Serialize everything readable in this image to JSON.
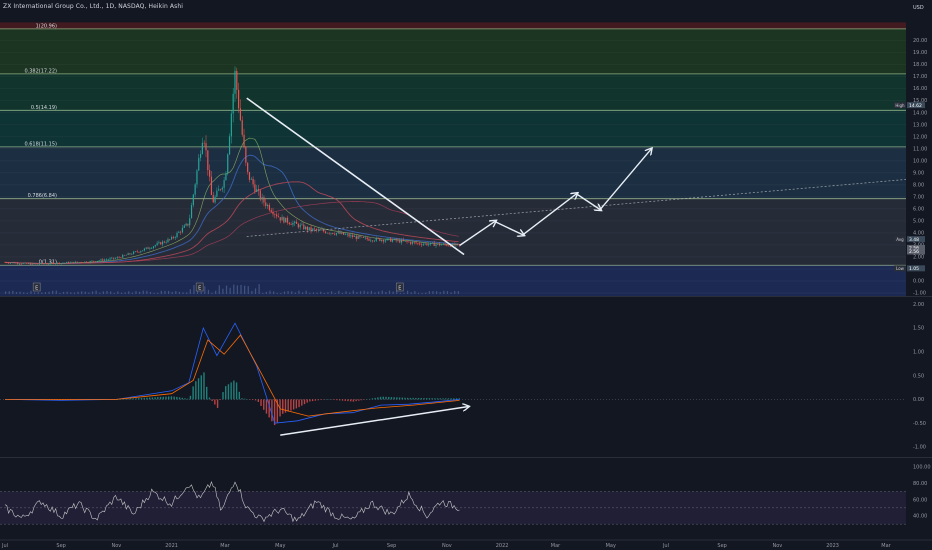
{
  "header": {
    "title": "ZX International Group Co., Ltd., 1D, NASDAQ, Heikin Ashi",
    "currency": "USD"
  },
  "colors": {
    "background": "#131722",
    "axis_text": "#9598a1",
    "candle_up": "#26a69a",
    "candle_down": "#ef5350",
    "macd_line": "#2962ff",
    "signal_line": "#ff6d00",
    "rsi_line": "#c9c9c9",
    "drawing": "#e8eef5",
    "fib_line": "#b9dba5"
  },
  "chart_data": [
    {
      "type": "line",
      "subtype": "candlestick-heikin-ashi",
      "title": "ZX International Group Co., Ltd., 1D, NASDAQ, Heikin Ashi",
      "ylim": [
        -1,
        21
      ],
      "yticks": [
        "-1.00",
        "0.00",
        "1.00",
        "2.00",
        "3.00",
        "4.00",
        "5.00",
        "6.00",
        "7.00",
        "8.00",
        "9.00",
        "10.00",
        "11.00",
        "12.00",
        "13.00",
        "14.00",
        "15.00",
        "16.00",
        "17.00",
        "18.00",
        "19.00",
        "20.00"
      ],
      "x_labels": [
        "Jul",
        "Sep",
        "Nov",
        "2021",
        "Mar",
        "May",
        "Jul",
        "Sep",
        "Nov",
        "2022",
        "Mar",
        "May",
        "Jul",
        "Sep",
        "Nov",
        "2023",
        "Mar"
      ],
      "price_path": [
        [
          "2020-07-01",
          1.55
        ],
        [
          "2020-08-01",
          1.4
        ],
        [
          "2020-09-01",
          1.5
        ],
        [
          "2020-10-01",
          1.6
        ],
        [
          "2020-11-01",
          1.9
        ],
        [
          "2020-12-01",
          2.6
        ],
        [
          "2021-01-01",
          3.5
        ],
        [
          "2021-01-20",
          4.8
        ],
        [
          "2021-02-05",
          12.5
        ],
        [
          "2021-02-15",
          6.5
        ],
        [
          "2021-03-01",
          8.5
        ],
        [
          "2021-03-12",
          17.2
        ],
        [
          "2021-03-25",
          9.0
        ],
        [
          "2021-04-10",
          6.8
        ],
        [
          "2021-05-01",
          5.2
        ],
        [
          "2021-06-01",
          4.3
        ],
        [
          "2021-07-01",
          4.0
        ],
        [
          "2021-08-01",
          3.5
        ],
        [
          "2021-09-01",
          3.4
        ],
        [
          "2021-10-01",
          3.1
        ],
        [
          "2021-11-01",
          3.0
        ],
        [
          "2021-11-15",
          2.95
        ]
      ],
      "fib_levels": [
        {
          "label": "1(20.96)",
          "value": 20.96
        },
        {
          "label": "0.382(17.22)",
          "value": 17.22
        },
        {
          "label": "0.5(14.19)",
          "value": 14.19
        },
        {
          "label": "0.618(11.15)",
          "value": 11.15
        },
        {
          "label": "0.786(6.84)",
          "value": 6.84
        },
        {
          "label": "0(1.31)",
          "value": 1.31
        }
      ],
      "price_labels": [
        {
          "tag": "High",
          "value": "14.62"
        },
        {
          "tag": "Avg",
          "value": "3.48"
        },
        {
          "tag": "",
          "value": "2.56"
        },
        {
          "tag": "",
          "value": "2.56"
        },
        {
          "tag": "Low",
          "value": "1.05"
        }
      ],
      "earnings_markers": [
        "E",
        "E",
        "E"
      ],
      "forecast_arrows": [
        {
          "from": [
            "2021-11-15",
            2.95
          ],
          "to": [
            "2021-12-25",
            5.0
          ]
        },
        {
          "from": [
            "2021-12-25",
            4.9
          ],
          "to": [
            "2022-01-25",
            3.8
          ]
        },
        {
          "from": [
            "2022-01-25",
            3.9
          ],
          "to": [
            "2022-03-25",
            7.3
          ]
        },
        {
          "from": [
            "2022-03-25",
            7.2
          ],
          "to": [
            "2022-04-20",
            5.9
          ]
        },
        {
          "from": [
            "2022-04-20",
            6.0
          ],
          "to": [
            "2022-06-15",
            11.0
          ]
        }
      ],
      "trend_line": {
        "from": [
          "2021-03-25",
          15.2
        ],
        "to": [
          "2021-11-20",
          2.2
        ]
      },
      "projection_dashed": {
        "from": [
          "2021-03-25",
          3.7
        ],
        "to": [
          "2023-04-01",
          8.5
        ]
      }
    },
    {
      "type": "line",
      "subtype": "macd",
      "ylim": [
        -1.0,
        2.0
      ],
      "yticks": [
        "-1.00",
        "-0.50",
        "0.00",
        "0.50",
        "1.00",
        "1.50",
        "2.00"
      ],
      "macd": [
        [
          "2020-07-01",
          0.0
        ],
        [
          "2020-09-01",
          -0.02
        ],
        [
          "2020-11-01",
          0.0
        ],
        [
          "2021-01-01",
          0.18
        ],
        [
          "2021-01-20",
          0.35
        ],
        [
          "2021-02-05",
          1.5
        ],
        [
          "2021-02-20",
          0.92
        ],
        [
          "2021-03-12",
          1.6
        ],
        [
          "2021-04-05",
          0.7
        ],
        [
          "2021-04-25",
          -0.5
        ],
        [
          "2021-05-20",
          -0.45
        ],
        [
          "2021-06-20",
          -0.3
        ],
        [
          "2021-07-20",
          -0.28
        ],
        [
          "2021-08-20",
          -0.12
        ],
        [
          "2021-09-20",
          -0.1
        ],
        [
          "2021-10-20",
          -0.05
        ],
        [
          "2021-11-15",
          0.0
        ]
      ],
      "signal": [
        [
          "2020-07-01",
          0.0
        ],
        [
          "2020-11-01",
          0.0
        ],
        [
          "2021-01-01",
          0.12
        ],
        [
          "2021-01-25",
          0.4
        ],
        [
          "2021-02-10",
          1.25
        ],
        [
          "2021-02-28",
          0.95
        ],
        [
          "2021-03-18",
          1.35
        ],
        [
          "2021-04-10",
          0.55
        ],
        [
          "2021-05-01",
          -0.2
        ],
        [
          "2021-06-01",
          -0.35
        ],
        [
          "2021-07-01",
          -0.28
        ],
        [
          "2021-08-15",
          -0.18
        ],
        [
          "2021-09-25",
          -0.12
        ],
        [
          "2021-11-15",
          -0.02
        ]
      ],
      "arrow": {
        "from": [
          "2021-05-01",
          -0.75
        ],
        "to": [
          "2021-11-25",
          -0.15
        ]
      }
    },
    {
      "type": "line",
      "subtype": "rsi",
      "ylim": [
        25,
        105
      ],
      "yticks": [
        "40.00",
        "60.00",
        "80.00",
        "100.00"
      ],
      "band": [
        30,
        70
      ],
      "rsi": [
        [
          "2020-07-01",
          50
        ],
        [
          "2020-07-20",
          37
        ],
        [
          "2020-08-10",
          58
        ],
        [
          "2020-09-01",
          40
        ],
        [
          "2020-09-20",
          55
        ],
        [
          "2020-10-10",
          36
        ],
        [
          "2020-11-01",
          64
        ],
        [
          "2020-11-20",
          42
        ],
        [
          "2020-12-10",
          70
        ],
        [
          "2021-01-01",
          55
        ],
        [
          "2021-01-20",
          80
        ],
        [
          "2021-02-01",
          60
        ],
        [
          "2021-02-15",
          82
        ],
        [
          "2021-02-25",
          45
        ],
        [
          "2021-03-12",
          85
        ],
        [
          "2021-03-25",
          50
        ],
        [
          "2021-04-10",
          36
        ],
        [
          "2021-05-01",
          48
        ],
        [
          "2021-05-20",
          34
        ],
        [
          "2021-06-10",
          58
        ],
        [
          "2021-07-01",
          40
        ],
        [
          "2021-07-20",
          35
        ],
        [
          "2021-08-10",
          56
        ],
        [
          "2021-09-01",
          42
        ],
        [
          "2021-09-20",
          66
        ],
        [
          "2021-10-10",
          40
        ],
        [
          "2021-10-25",
          58
        ],
        [
          "2021-11-15",
          50
        ]
      ]
    }
  ]
}
